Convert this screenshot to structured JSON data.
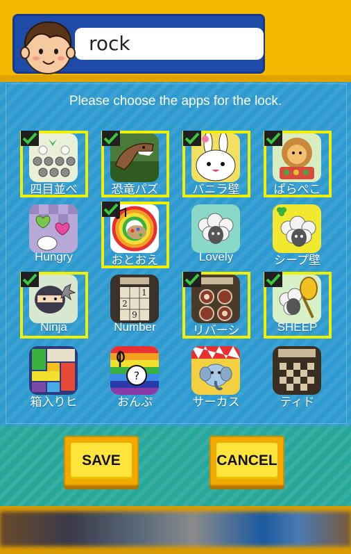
{
  "header": {
    "user_name": "rock"
  },
  "instruction": "Please choose the apps for the lock.",
  "apps": [
    {
      "label": "四目並べ",
      "icon": "gomoku-icon",
      "selected": true
    },
    {
      "label": "恐竜パズ",
      "icon": "dinosaur-icon",
      "selected": true
    },
    {
      "label": "バニラ壁",
      "icon": "bunny-icon",
      "selected": true
    },
    {
      "label": "ぱらぺこ",
      "icon": "lion-icon",
      "selected": true
    },
    {
      "label": "Hungry",
      "icon": "hungry-bunny-icon",
      "selected": false
    },
    {
      "label": "おとおえ",
      "icon": "palette-icon",
      "selected": true
    },
    {
      "label": "Lovely",
      "icon": "sheep-icon",
      "selected": false
    },
    {
      "label": "シープ壁",
      "icon": "sheep-clover-icon",
      "selected": false
    },
    {
      "label": "Ninja",
      "icon": "ninja-icon",
      "selected": true
    },
    {
      "label": "Number",
      "icon": "sudoku-icon",
      "selected": false
    },
    {
      "label": "リバーシ",
      "icon": "reversi-icon",
      "selected": true
    },
    {
      "label": "SHEEP",
      "icon": "sheep-racket-icon",
      "selected": true
    },
    {
      "label": "箱入りヒ",
      "icon": "box-puzzle-icon",
      "selected": false
    },
    {
      "label": "おんぷ",
      "icon": "music-note-icon",
      "selected": false
    },
    {
      "label": "サーカス",
      "icon": "circus-elephant-icon",
      "selected": false
    },
    {
      "label": "ティド",
      "icon": "chess-icon",
      "selected": false
    }
  ],
  "buttons": {
    "save": "SAVE",
    "cancel": "CANCEL"
  },
  "colors": {
    "header_bg": "#F5B800",
    "name_frame": "#1E4BA8",
    "main_bg": "#2E9BD0",
    "selection_border": "#F0F000",
    "check": "#3CC83C",
    "bottom_bg": "#28A89A",
    "button_face": "#FFE53B"
  }
}
